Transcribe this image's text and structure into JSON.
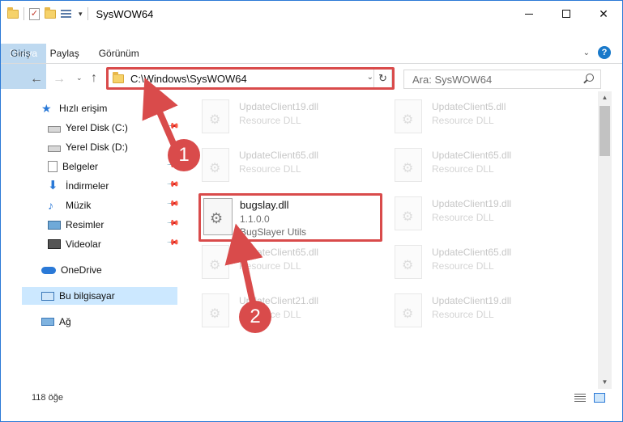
{
  "window": {
    "title": "SysWOW64"
  },
  "ribbon": {
    "tabs": [
      "Dosya",
      "Giriş",
      "Paylaş",
      "Görünüm"
    ]
  },
  "nav": {
    "address": "C:\\Windows\\SysWOW64",
    "search_placeholder": "Ara: SysWOW64"
  },
  "sidebar": {
    "items": [
      {
        "label": "Hızlı erişim",
        "icon": "star-icon"
      },
      {
        "label": "Yerel Disk (C:)",
        "icon": "drive-icon"
      },
      {
        "label": "Yerel Disk (D:)",
        "icon": "drive-icon"
      },
      {
        "label": "Belgeler",
        "icon": "documents-icon"
      },
      {
        "label": "İndirmeler",
        "icon": "downloads-icon"
      },
      {
        "label": "Müzik",
        "icon": "music-icon"
      },
      {
        "label": "Resimler",
        "icon": "pictures-icon"
      },
      {
        "label": "Videolar",
        "icon": "videos-icon"
      },
      {
        "label": "OneDrive",
        "icon": "onedrive-icon"
      },
      {
        "label": "Bu bilgisayar",
        "icon": "this-pc-icon"
      },
      {
        "label": "Ağ",
        "icon": "network-icon"
      }
    ]
  },
  "files": [
    {
      "name": "UpdateClient19.dll",
      "desc": "Resource DLL"
    },
    {
      "name": "UpdateClient5.dll",
      "desc": "Resource DLL"
    },
    {
      "name": "UpdateClient65.dll",
      "desc": "Resource DLL"
    },
    {
      "name": "UpdateClient65.dll",
      "desc": "Resource DLL"
    },
    {
      "name": "UpdateClient19.dll",
      "desc": "Resource DLL"
    },
    {
      "name": "UpdateClient65.dll",
      "desc": "Resource DLL"
    },
    {
      "name": "UpdateClient65.dll",
      "desc": "Resource DLL"
    },
    {
      "name": "UpdateClient21.dll",
      "desc": "Resource DLL"
    },
    {
      "name": "UpdateClient19.dll",
      "desc": "Resource DLL"
    }
  ],
  "highlighted_file": {
    "name": "bugslay.dll",
    "version": "1.1.0.0",
    "desc": "BugSlayer Utils"
  },
  "status": {
    "item_count": "118 öğe"
  },
  "annotations": {
    "step1": "1",
    "step2": "2"
  },
  "colors": {
    "accent": "#1979ca",
    "highlight": "#d94b4b",
    "selection": "#cce8ff"
  }
}
